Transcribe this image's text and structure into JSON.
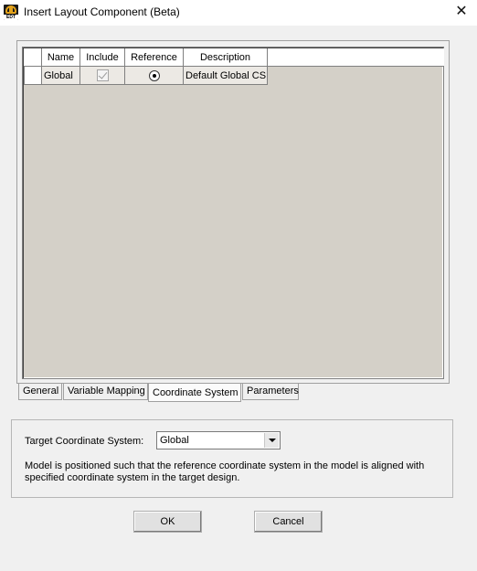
{
  "window": {
    "title": "Insert Layout Component (Beta)",
    "icon_label": "EDT",
    "close_glyph": "✕"
  },
  "grid": {
    "columns": [
      "Name",
      "Include",
      "Reference",
      "Description"
    ],
    "rows": [
      {
        "name": "Global",
        "include": true,
        "reference": true,
        "description": "Default Global CS"
      }
    ]
  },
  "tabs": [
    {
      "label": "General",
      "active": false
    },
    {
      "label": "Variable Mapping",
      "active": false
    },
    {
      "label": "Coordinate System",
      "active": true
    },
    {
      "label": "Parameters",
      "active": false
    }
  ],
  "target": {
    "label": "Target Coordinate System:",
    "value": "Global",
    "description": "Model is positioned such that the reference coordinate system in the model is aligned with specified coordinate system in the target design."
  },
  "buttons": {
    "ok": "OK",
    "cancel": "Cancel"
  }
}
